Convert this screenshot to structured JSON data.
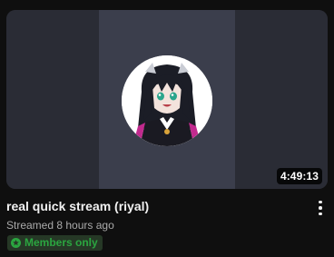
{
  "video": {
    "duration": "4:49:13",
    "title": "real quick stream (riyal)",
    "streamed": "Streamed 8 hours ago",
    "badge": {
      "label": "Members only",
      "icon": "members-star-icon"
    }
  },
  "colors": {
    "background": "#0f0f0f",
    "title": "#f1f1f1",
    "meta": "#aaaaaa",
    "badge_text": "#2ba640",
    "badge_bg": "#263826"
  }
}
